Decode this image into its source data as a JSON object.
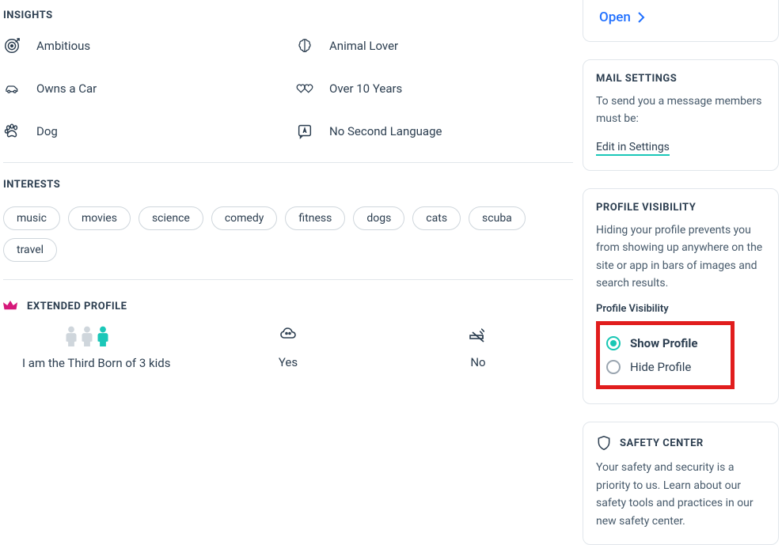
{
  "insights": {
    "title": "INSIGHTS",
    "items": [
      {
        "label": "Ambitious"
      },
      {
        "label": "Animal Lover"
      },
      {
        "label": "Owns a Car"
      },
      {
        "label": "Over 10 Years"
      },
      {
        "label": "Dog"
      },
      {
        "label": "No Second Language"
      }
    ]
  },
  "interests": {
    "title": "INTERESTS",
    "pills": [
      "music",
      "movies",
      "science",
      "comedy",
      "fitness",
      "dogs",
      "cats",
      "scuba",
      "travel"
    ]
  },
  "extended": {
    "title": "EXTENDED PROFILE",
    "birth_label": "I am the Third Born of 3 kids",
    "q2_label": "Yes",
    "q3_label": "No"
  },
  "sidebar": {
    "open_label": "Open",
    "mail": {
      "title": "MAIL SETTINGS",
      "body": "To send you a message members must be:",
      "edit": "Edit in Settings"
    },
    "visibility": {
      "title": "PROFILE VISIBILITY",
      "body": "Hiding your profile prevents you from showing up anywhere on the site or app in bars of images and search results.",
      "sub": "Profile Visibility",
      "show": "Show Profile",
      "hide": "Hide Profile"
    },
    "safety": {
      "title": "SAFETY CENTER",
      "body": "Your safety and security is a priority to us. Learn about our safety tools and practices in our new safety center."
    }
  }
}
